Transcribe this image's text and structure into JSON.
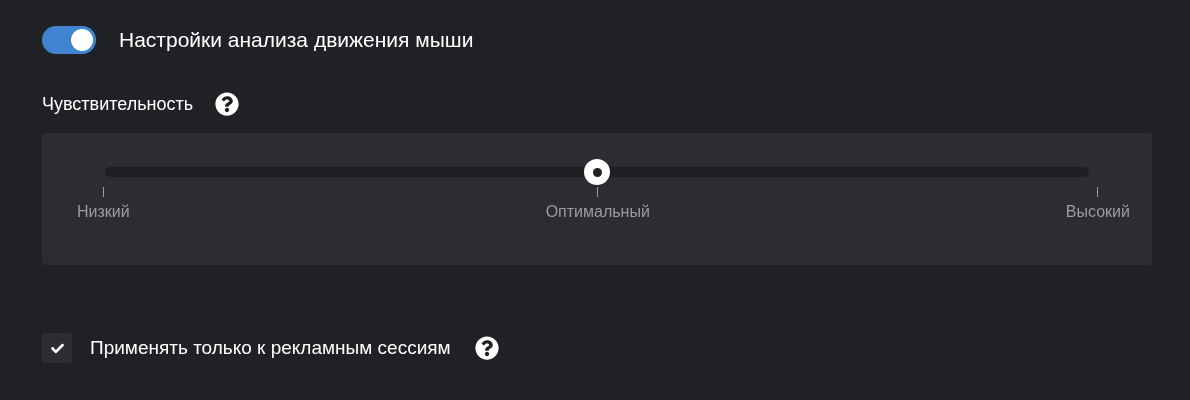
{
  "header": {
    "toggle": {
      "on": true
    },
    "title": "Настройки анализа движения мыши"
  },
  "sensitivity": {
    "label": "Чувствительность",
    "slider": {
      "level": 0.5
    },
    "stops": [
      {
        "label": "Низкий"
      },
      {
        "label": "Оптимальный"
      },
      {
        "label": "Высокий"
      }
    ]
  },
  "ad_sessions": {
    "checked": true,
    "label": "Применять только к рекламным сессиям"
  }
}
